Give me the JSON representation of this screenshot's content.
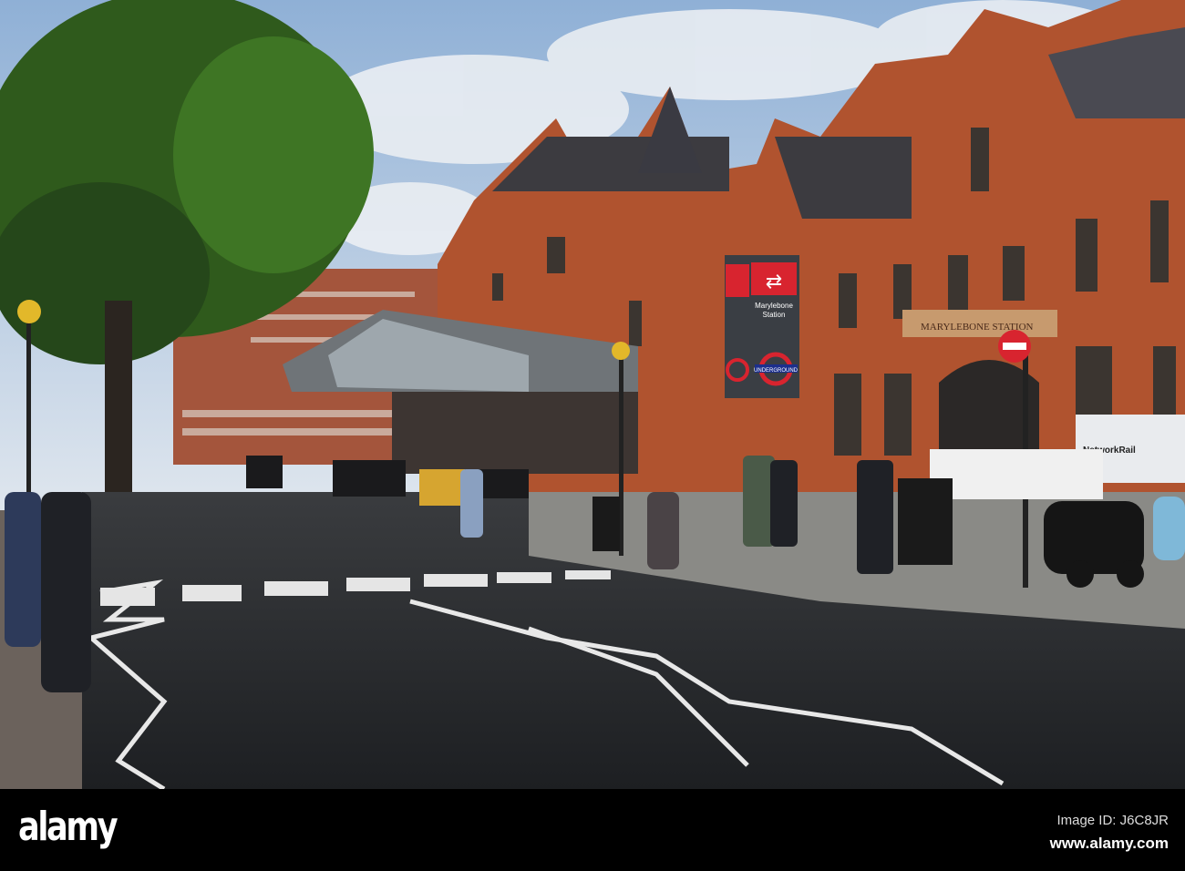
{
  "scene": {
    "station_sign": {
      "line1": "Marylebone",
      "line2": "Station",
      "underground_label": "UNDERGROUND"
    },
    "facade_lettering": "MARYLEBONE STATION",
    "van_label": "NetworkRail"
  },
  "colors": {
    "sky": "#b9cde3",
    "brick": "#b0532f",
    "asphalt": "#26282b",
    "pavement": "#8a8a86",
    "tree": "#2f5a1c",
    "rail_red": "#d8242f",
    "underground_blue": "#1c2f8c"
  },
  "watermark": {
    "logo": "alamy",
    "image_id": "Image ID: J6C8JR",
    "url": "www.alamy.com"
  }
}
